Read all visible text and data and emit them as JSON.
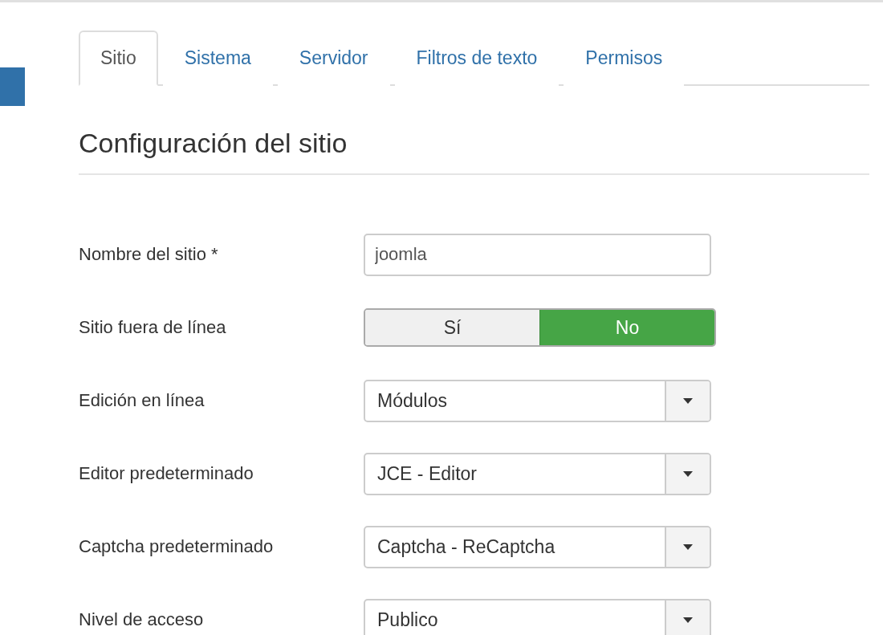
{
  "tabs": [
    {
      "label": "Sitio",
      "selected": true
    },
    {
      "label": "Sistema",
      "selected": false
    },
    {
      "label": "Servidor",
      "selected": false
    },
    {
      "label": "Filtros de texto",
      "selected": false
    },
    {
      "label": "Permisos",
      "selected": false
    }
  ],
  "heading": "Configuración del sitio",
  "fields": [
    {
      "kind": "text",
      "label": "Nombre del sitio *",
      "value": "joomla"
    },
    {
      "kind": "toggle",
      "label": "Sitio fuera de línea",
      "options": [
        {
          "label": "Sí",
          "selected": false
        },
        {
          "label": "No",
          "selected": true
        }
      ]
    },
    {
      "kind": "select",
      "label": "Edición en línea",
      "value": "Módulos"
    },
    {
      "kind": "select",
      "label": "Editor predeterminado",
      "value": "JCE - Editor"
    },
    {
      "kind": "select",
      "label": "Captcha predeterminado",
      "value": "Captcha - ReCaptcha"
    },
    {
      "kind": "select",
      "label": "Nivel de acceso",
      "value": "Publico"
    }
  ]
}
